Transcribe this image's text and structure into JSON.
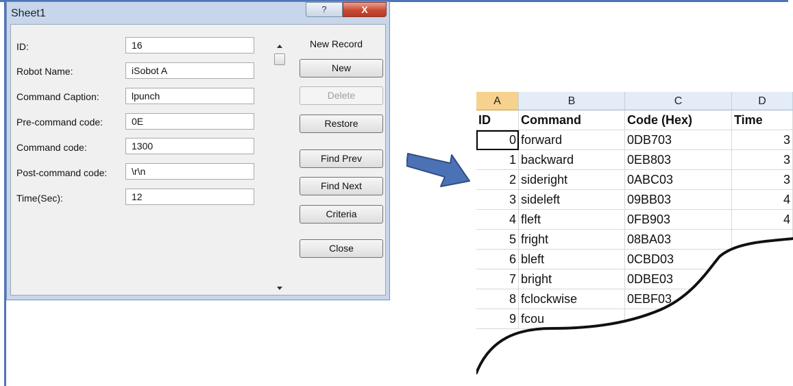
{
  "dialog": {
    "title": "Sheet1",
    "help_label": "?",
    "close_label": "X",
    "record_status": "New Record",
    "fields": [
      {
        "label": "ID:",
        "value": "16"
      },
      {
        "label": "Robot Name:",
        "value": "iSobot A"
      },
      {
        "label": "Command Caption:",
        "value": "lpunch"
      },
      {
        "label": "Pre-command code:",
        "value": "0E"
      },
      {
        "label": "Command code:",
        "value": "1300"
      },
      {
        "label": "Post-command code:",
        "value": "\\r\\n"
      },
      {
        "label": "Time(Sec):",
        "value": "12"
      }
    ],
    "buttons": {
      "new": "New",
      "delete": "Delete",
      "restore": "Restore",
      "find_prev": "Find Prev",
      "find_next": "Find Next",
      "criteria": "Criteria",
      "close": "Close"
    }
  },
  "spreadsheet": {
    "columns": [
      "A",
      "B",
      "C",
      "D"
    ],
    "header_row": [
      "ID",
      "Command",
      "Code (Hex)",
      "Time"
    ],
    "rows": [
      [
        "0",
        "forward",
        "0DB703",
        "3"
      ],
      [
        "1",
        "backward",
        "0EB803",
        "3"
      ],
      [
        "2",
        "sideright",
        "0ABC03",
        "3"
      ],
      [
        "3",
        "sideleft",
        "09BB03",
        "4"
      ],
      [
        "4",
        "fleft",
        "0FB903",
        "4"
      ],
      [
        "5",
        "fright",
        "08BA03",
        ""
      ],
      [
        "6",
        "bleft",
        "0CBD03",
        ""
      ],
      [
        "7",
        "bright",
        "0DBE03",
        ""
      ],
      [
        "8",
        "fclockwise",
        "0EBF03",
        ""
      ],
      [
        "9",
        "fcou",
        "",
        ""
      ]
    ]
  },
  "colors": {
    "frame": "#4f74b8",
    "arrow_fill": "#4a72b5",
    "header_fill": "#e4ecf7",
    "selected_header": "#f7d28e"
  }
}
